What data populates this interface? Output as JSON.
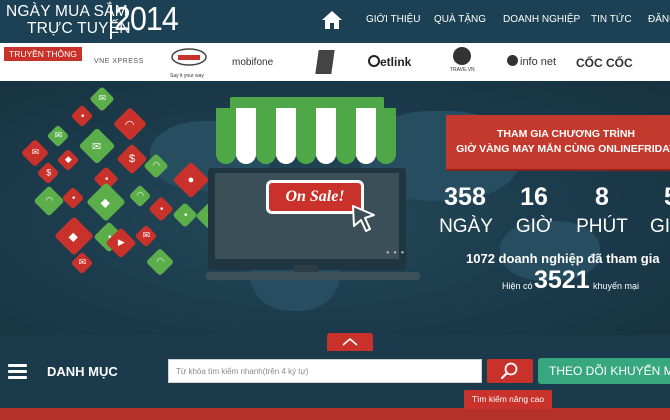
{
  "header": {
    "logo_line1": "NGÀY MUA SẮM",
    "logo_line2": "TRỰC TUYẾN",
    "logo_year": "2014",
    "home_icon": "home-icon",
    "nav": [
      {
        "label": "GIỚI THIỆU"
      },
      {
        "label": "QUÀ TẶNG"
      },
      {
        "label": "DOANH NGHIỆP"
      },
      {
        "label": "TIN TỨC"
      },
      {
        "label": "ĐĂNG"
      }
    ]
  },
  "partners": {
    "label": "TRUYỀN THÔNG",
    "logos": [
      {
        "name": "VNEXPRESS",
        "sub": "VNE XPRESS"
      },
      {
        "name": "VIETTEL",
        "sub": "Say it your way"
      },
      {
        "name": "mobifone",
        "sub": ""
      },
      {
        "name": "VNG",
        "sub": ""
      },
      {
        "name": "etlink",
        "sub": ""
      },
      {
        "name": "TRAVEL",
        "sub": "TRAVE.VN"
      },
      {
        "name": "info net",
        "sub": ""
      },
      {
        "name": "CỐC CỐC",
        "sub": ""
      }
    ]
  },
  "hero": {
    "sale_sign": "On Sale!",
    "promo_line1": "THAM GIA CHƯƠNG TRÌNH",
    "promo_line2": "GIỜ VÀNG MAY MẮN CÙNG ONLINEFRIDAY",
    "countdown": [
      {
        "value": "358",
        "unit": "NGÀY"
      },
      {
        "value": "16",
        "unit": "GIỜ"
      },
      {
        "value": "8",
        "unit": "PHÚT"
      },
      {
        "value": "5",
        "unit": "GIÂ"
      }
    ],
    "joined_text": "1072 doanh nghiệp đã tham gia",
    "offers_prefix": "Hiện có",
    "offers_count": "3521",
    "offers_suffix": "khuyến mại"
  },
  "category_bar": {
    "menu_icon": "hamburger-menu-icon",
    "label": "DANH MỤC",
    "search_placeholder": "Từ khóa tìm kiếm nhanh(trên 4 ký tự)",
    "search_icon": "search-icon",
    "advanced_search": "Tìm kiếm nâng cao",
    "follow_button": "THEO DÕI KHUYẾN MẠI"
  },
  "colors": {
    "header_bg": "#1c4154",
    "accent_red": "#c8322a",
    "green": "#36a77e"
  }
}
